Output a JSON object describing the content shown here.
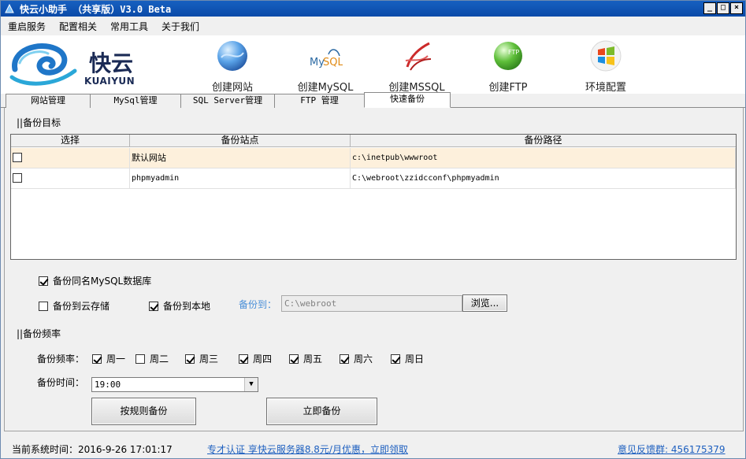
{
  "window": {
    "title": "快云小助手 （共享版）V3.0 Beta",
    "min": "_",
    "max": "□",
    "close": "×"
  },
  "menu": [
    "重启服务",
    "配置相关",
    "常用工具",
    "关于我们"
  ],
  "logo": {
    "brand": "快云",
    "brand_en": "KUAIYUN"
  },
  "toolbar": [
    "创建网站",
    "创建MySQL",
    "创建MSSQL",
    "创建FTP",
    "环境配置"
  ],
  "tabs": [
    "网站管理",
    "MySql管理",
    "SQL Server管理",
    "FTP 管理",
    "快速备份"
  ],
  "backup_target": {
    "section_title": "||备份目标",
    "columns": [
      "选择",
      "备份站点",
      "备份路径"
    ],
    "rows": [
      {
        "selected": false,
        "site": "默认网站",
        "path": "c:\\inetpub\\wwwroot"
      },
      {
        "selected": false,
        "site": "phpmyadmin",
        "path": "C:\\webroot\\zzidcconf\\phpmyadmin"
      }
    ]
  },
  "options": {
    "mysql_same_name": {
      "label": "备份同名MySQL数据库",
      "checked": true
    },
    "cloud": {
      "label": "备份到云存储",
      "checked": false
    },
    "local": {
      "label": "备份到本地",
      "checked": true
    },
    "dest_label": "备份到：",
    "dest_path": "C:\\webroot",
    "browse": "浏览..."
  },
  "frequency": {
    "section_title": "||备份频率",
    "label": "备份频率：",
    "days": [
      {
        "label": "周一",
        "checked": true
      },
      {
        "label": "周二",
        "checked": false
      },
      {
        "label": "周三",
        "checked": true
      },
      {
        "label": "周四",
        "checked": true
      },
      {
        "label": "周五",
        "checked": true
      },
      {
        "label": "周六",
        "checked": true
      },
      {
        "label": "周日",
        "checked": true
      }
    ],
    "time_label": "备份时间：",
    "time_value": "19:00",
    "btn_rule": "按规则备份",
    "btn_now": "立即备份"
  },
  "status": {
    "time_text": "当前系统时间：2016-9-26 17:01:17",
    "promo": "专才认证   享快云服务器8.8元/月优惠，立即领取",
    "feedback": "意见反馈群: 456175379"
  },
  "colors": {
    "title_bar": "#0a4aa8",
    "selected_row": "#fdf0dc",
    "link": "#1d5fbf"
  }
}
